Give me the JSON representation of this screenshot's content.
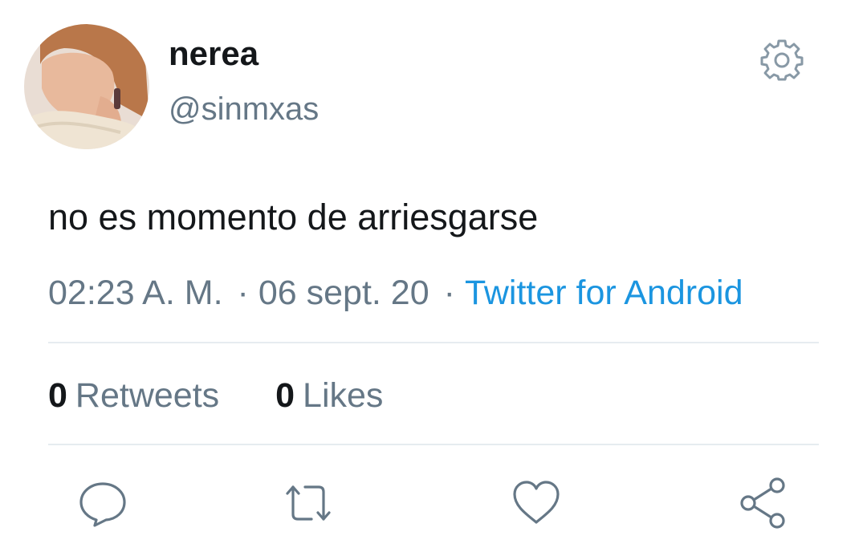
{
  "user": {
    "display_name": "nerea",
    "handle": "@sinmxas"
  },
  "tweet": {
    "text": "no es momento de arriesgarse",
    "time": "02:23 A. M.",
    "date": "06 sept. 20",
    "separator": "·",
    "source": "Twitter for Android"
  },
  "stats": {
    "retweets_count": "0",
    "retweets_label": "Retweets",
    "likes_count": "0",
    "likes_label": "Likes"
  },
  "icons": {
    "settings": "gear-icon",
    "reply": "reply-icon",
    "retweet": "retweet-icon",
    "like": "heart-icon",
    "share": "share-icon"
  },
  "colors": {
    "text_primary": "#14171a",
    "text_secondary": "#657786",
    "link": "#1b95e0",
    "divider": "#e6ecf0",
    "icon": "#657786"
  }
}
